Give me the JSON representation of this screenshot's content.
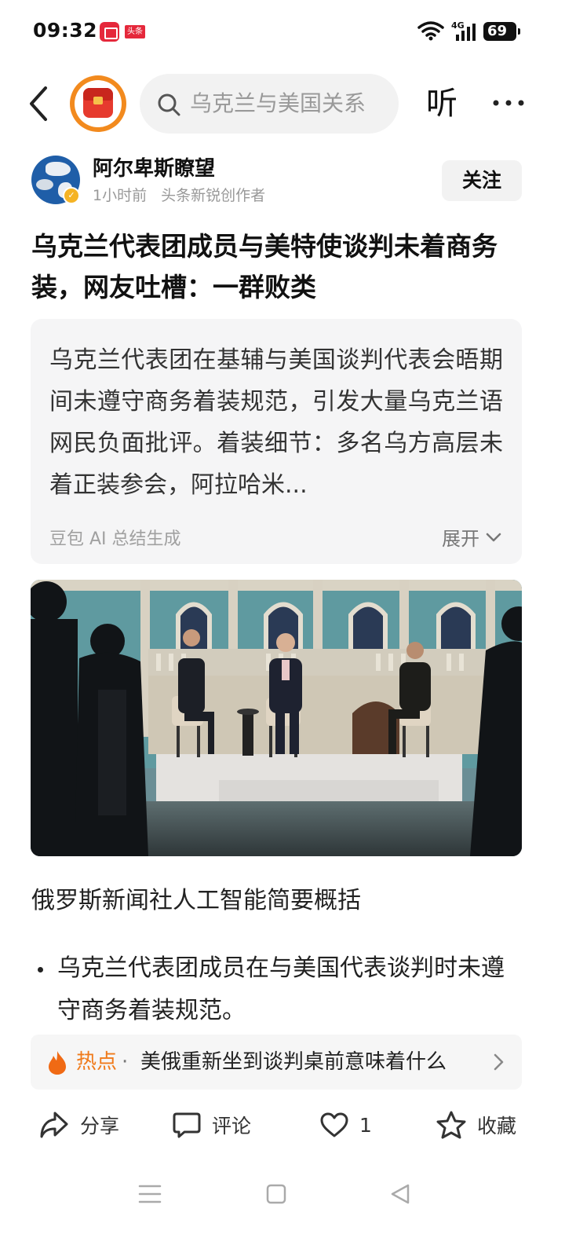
{
  "status_bar": {
    "time": "09:32",
    "app_badge": "头条",
    "network": "4G",
    "battery": "69"
  },
  "top_bar": {
    "search_text": "乌克兰与美国关系",
    "listen_label": "听"
  },
  "author": {
    "name": "阿尔卑斯瞭望",
    "time_ago": "1小时前",
    "creator_tag": "头条新锐创作者",
    "follow_label": "关注"
  },
  "article": {
    "title": "乌克兰代表团成员与美特使谈判未着商务装，网友吐槽：一群败类",
    "ai_summary": {
      "text": "乌克兰代表团在基辅与美国谈判代表会晤期间未遵守商务着装规范，引发大量乌克兰语网民负面批评。着装细节：多名乌方高层未着正装参会，阿拉哈米...",
      "source": "豆包 AI 总结生成",
      "expand_label": "展开"
    },
    "sub_heading": "俄罗斯新闻社人工智能简要概括",
    "bullets": [
      "乌克兰代表团成员在与美国代表谈判时未遵守商务着装规范。"
    ]
  },
  "hot_topic": {
    "label": "热点",
    "separator": "·",
    "text": "美俄重新坐到谈判桌前意味着什么"
  },
  "actions": {
    "share_label": "分享",
    "comment_label": "评论",
    "like_count": "1",
    "favorite_label": "收藏"
  },
  "colors": {
    "accent_orange": "#f07a1a",
    "brand_red": "#e63a2e",
    "logo_ring": "#f28a1e"
  }
}
